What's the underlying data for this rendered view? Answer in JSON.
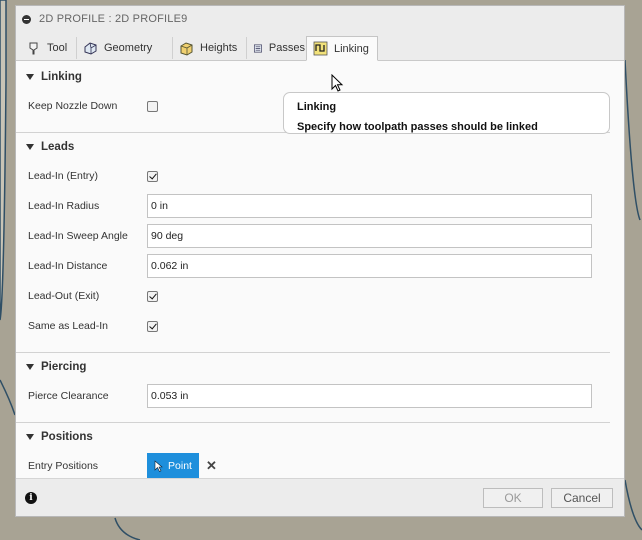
{
  "window": {
    "title": "2D PROFILE : 2D PROFILE9"
  },
  "tabs": [
    {
      "label": "Tool",
      "icon": "tool-icon"
    },
    {
      "label": "Geometry",
      "icon": "geometry-icon"
    },
    {
      "label": "Heights",
      "icon": "heights-icon"
    },
    {
      "label": "Passes",
      "icon": "passes-icon"
    },
    {
      "label": "Linking",
      "icon": "linking-icon",
      "active": true
    }
  ],
  "sections": {
    "linking": {
      "title": "Linking",
      "keep_nozzle_down": {
        "label": "Keep Nozzle Down",
        "checked": false
      }
    },
    "leads": {
      "title": "Leads",
      "lead_in": {
        "label": "Lead-In (Entry)",
        "checked": true
      },
      "lead_in_radius": {
        "label": "Lead-In Radius",
        "value": "0 in"
      },
      "lead_in_sweep": {
        "label": "Lead-In Sweep Angle",
        "value": "90 deg"
      },
      "lead_in_distance": {
        "label": "Lead-In Distance",
        "value": "0.062 in"
      },
      "lead_out": {
        "label": "Lead-Out (Exit)",
        "checked": true
      },
      "same_as_lead_in": {
        "label": "Same as Lead-In",
        "checked": true
      }
    },
    "piercing": {
      "title": "Piercing",
      "pierce_clearance": {
        "label": "Pierce Clearance",
        "value": "0.053 in"
      }
    },
    "positions": {
      "title": "Positions",
      "entry_positions": {
        "label": "Entry Positions",
        "button": "Point"
      }
    }
  },
  "tooltip": {
    "title": "Linking",
    "description": "Specify how toolpath passes should be linked"
  },
  "footer": {
    "ok": "OK",
    "cancel": "Cancel"
  },
  "colors": {
    "accent": "#1e8fdc",
    "background": "#a8a394",
    "dialog": "#fafafa"
  }
}
